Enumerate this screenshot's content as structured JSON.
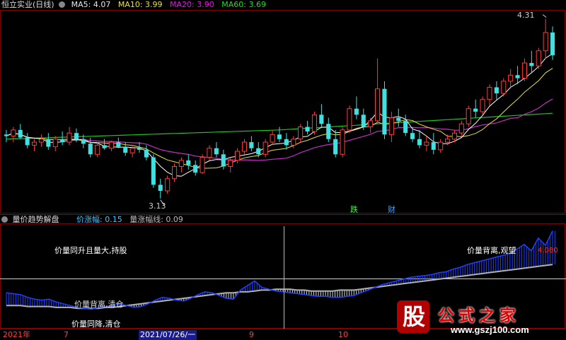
{
  "header": {
    "title": "恒立实业(日线)",
    "ma5_label": "MA5:",
    "ma5_value": "4.07",
    "ma10_label": "MA10:",
    "ma10_value": "3.99",
    "ma20_label": "MA20:",
    "ma20_value": "3.90",
    "ma60_label": "MA60:",
    "ma60_value": "3.69"
  },
  "sub_header": {
    "title": "量价趋势解盘",
    "line1_label": "价涨幅:",
    "line1_value": "0.15",
    "line2_label": "量涨幅线:",
    "line2_value": "0.09"
  },
  "annotations": {
    "high": "4.31",
    "low": "3.13",
    "event1": "跌",
    "event2": "财",
    "sub_value": "4.080",
    "text_hold": "价量同升且量大,持股",
    "text_watch": "价量背离,观望",
    "text_reduce": "价量背离,清仓",
    "text_clear": "价量同降,清仓"
  },
  "x_axis": {
    "labels": [
      "2021年",
      "7",
      "2021/07/26/一",
      "9",
      "10"
    ]
  },
  "watermark": {
    "char": "股",
    "text": "公式之家",
    "url": "www.gszj100.com"
  },
  "colors": {
    "up": "#ff3a3a",
    "down": "#40e0e0",
    "ma5": "#ffffff",
    "ma10": "#e8e040",
    "ma20": "#c030c0",
    "ma60": "#22c022",
    "sub_blue": "#2040ff",
    "sub_gray": "#b0b0b0",
    "grid_red": "#7a0000"
  },
  "chart_data": [
    {
      "type": "candlestick",
      "title": "恒立实业(日线)",
      "price_range": [
        3.05,
        4.35
      ],
      "candles": [
        [
          3.55,
          3.58,
          3.5,
          3.54
        ],
        [
          3.54,
          3.6,
          3.5,
          3.58
        ],
        [
          3.58,
          3.62,
          3.52,
          3.53
        ],
        [
          3.53,
          3.56,
          3.46,
          3.48
        ],
        [
          3.48,
          3.52,
          3.44,
          3.5
        ],
        [
          3.5,
          3.55,
          3.47,
          3.52
        ],
        [
          3.52,
          3.56,
          3.45,
          3.47
        ],
        [
          3.47,
          3.54,
          3.44,
          3.52
        ],
        [
          3.52,
          3.57,
          3.48,
          3.5
        ],
        [
          3.5,
          3.6,
          3.48,
          3.56
        ],
        [
          3.56,
          3.59,
          3.5,
          3.52
        ],
        [
          3.52,
          3.55,
          3.46,
          3.49
        ],
        [
          3.49,
          3.53,
          3.4,
          3.42
        ],
        [
          3.42,
          3.5,
          3.4,
          3.48
        ],
        [
          3.48,
          3.52,
          3.45,
          3.46
        ],
        [
          3.46,
          3.51,
          3.44,
          3.5
        ],
        [
          3.5,
          3.53,
          3.46,
          3.47
        ],
        [
          3.47,
          3.5,
          3.41,
          3.43
        ],
        [
          3.43,
          3.48,
          3.4,
          3.46
        ],
        [
          3.46,
          3.5,
          3.43,
          3.45
        ],
        [
          3.45,
          3.48,
          3.38,
          3.4
        ],
        [
          3.4,
          3.42,
          3.2,
          3.22
        ],
        [
          3.22,
          3.26,
          3.13,
          3.18
        ],
        [
          3.18,
          3.28,
          3.16,
          3.26
        ],
        [
          3.26,
          3.36,
          3.24,
          3.34
        ],
        [
          3.34,
          3.4,
          3.3,
          3.38
        ],
        [
          3.38,
          3.42,
          3.32,
          3.35
        ],
        [
          3.35,
          3.38,
          3.28,
          3.3
        ],
        [
          3.3,
          3.42,
          3.29,
          3.4
        ],
        [
          3.4,
          3.48,
          3.38,
          3.46
        ],
        [
          3.46,
          3.5,
          3.4,
          3.42
        ],
        [
          3.42,
          3.45,
          3.32,
          3.34
        ],
        [
          3.34,
          3.4,
          3.3,
          3.38
        ],
        [
          3.38,
          3.46,
          3.36,
          3.44
        ],
        [
          3.44,
          3.52,
          3.42,
          3.5
        ],
        [
          3.5,
          3.54,
          3.44,
          3.46
        ],
        [
          3.46,
          3.5,
          3.4,
          3.42
        ],
        [
          3.42,
          3.52,
          3.4,
          3.5
        ],
        [
          3.5,
          3.58,
          3.48,
          3.55
        ],
        [
          3.55,
          3.6,
          3.5,
          3.52
        ],
        [
          3.52,
          3.56,
          3.45,
          3.48
        ],
        [
          3.48,
          3.54,
          3.46,
          3.52
        ],
        [
          3.52,
          3.62,
          3.5,
          3.6
        ],
        [
          3.6,
          3.64,
          3.55,
          3.57
        ],
        [
          3.57,
          3.7,
          3.55,
          3.68
        ],
        [
          3.68,
          3.75,
          3.6,
          3.62
        ],
        [
          3.62,
          3.66,
          3.5,
          3.52
        ],
        [
          3.52,
          3.58,
          3.4,
          3.42
        ],
        [
          3.42,
          3.6,
          3.4,
          3.58
        ],
        [
          3.58,
          3.74,
          3.56,
          3.72
        ],
        [
          3.72,
          3.8,
          3.65,
          3.68
        ],
        [
          3.68,
          3.72,
          3.58,
          3.6
        ],
        [
          3.6,
          3.66,
          3.56,
          3.64
        ],
        [
          3.64,
          4.05,
          3.62,
          3.85
        ],
        [
          3.85,
          3.9,
          3.52,
          3.55
        ],
        [
          3.55,
          3.7,
          3.5,
          3.66
        ],
        [
          3.66,
          3.72,
          3.6,
          3.64
        ],
        [
          3.64,
          3.68,
          3.54,
          3.56
        ],
        [
          3.56,
          3.6,
          3.5,
          3.52
        ],
        [
          3.52,
          3.58,
          3.46,
          3.48
        ],
        [
          3.48,
          3.54,
          3.44,
          3.5
        ],
        [
          3.5,
          3.56,
          3.42,
          3.45
        ],
        [
          3.45,
          3.52,
          3.43,
          3.5
        ],
        [
          3.5,
          3.55,
          3.48,
          3.52
        ],
        [
          3.52,
          3.58,
          3.5,
          3.56
        ],
        [
          3.56,
          3.64,
          3.54,
          3.62
        ],
        [
          3.62,
          3.74,
          3.6,
          3.72
        ],
        [
          3.72,
          3.78,
          3.66,
          3.7
        ],
        [
          3.7,
          3.8,
          3.68,
          3.78
        ],
        [
          3.78,
          3.88,
          3.74,
          3.86
        ],
        [
          3.86,
          3.9,
          3.78,
          3.82
        ],
        [
          3.82,
          3.92,
          3.8,
          3.9
        ],
        [
          3.9,
          3.98,
          3.86,
          3.94
        ],
        [
          3.94,
          4.0,
          3.88,
          3.92
        ],
        [
          3.92,
          4.05,
          3.9,
          4.02
        ],
        [
          4.02,
          4.1,
          3.96,
          4.0
        ],
        [
          4.0,
          4.12,
          3.98,
          4.1
        ],
        [
          4.1,
          4.31,
          4.05,
          4.22
        ],
        [
          4.22,
          4.26,
          4.04,
          4.07
        ]
      ],
      "ma60": [
        3.52,
        3.58,
        3.69
      ],
      "high_label": 4.31,
      "low_label": 3.13
    },
    {
      "type": "line",
      "title": "量价趋势解盘",
      "series": [
        {
          "name": "价涨幅",
          "values": [
            0.02,
            0.01,
            0.0,
            -0.03,
            -0.05,
            -0.06,
            -0.05,
            -0.08,
            -0.1,
            -0.12,
            -0.14,
            -0.15,
            -0.16,
            -0.14,
            -0.13,
            -0.12,
            -0.1,
            -0.12,
            -0.14,
            -0.13,
            -0.1,
            -0.06,
            -0.03,
            -0.04,
            -0.06,
            -0.07,
            -0.04,
            0.0,
            0.03,
            0.02,
            -0.01,
            -0.04,
            -0.05,
            0.05,
            0.1,
            0.15,
            0.08,
            0.06,
            0.04,
            0.03,
            0.02,
            0.01,
            0.0,
            -0.01,
            -0.02,
            -0.02,
            -0.03,
            -0.03,
            -0.02,
            -0.01,
            0.02,
            0.05,
            0.08,
            0.11,
            0.13,
            0.15,
            0.17,
            0.19,
            0.2,
            0.21,
            0.22,
            0.24,
            0.25,
            0.28,
            0.3,
            0.33,
            0.35,
            0.37,
            0.39,
            0.41,
            0.43,
            0.45,
            0.5,
            0.55,
            0.48,
            0.62,
            0.54,
            0.7
          ]
        },
        {
          "name": "量涨幅线",
          "values": [
            -0.12,
            -0.12,
            -0.12,
            -0.13,
            -0.13,
            -0.13,
            -0.13,
            -0.14,
            -0.14,
            -0.14,
            -0.15,
            -0.15,
            -0.15,
            -0.15,
            -0.14,
            -0.14,
            -0.13,
            -0.12,
            -0.11,
            -0.1,
            -0.09,
            -0.08,
            -0.07,
            -0.06,
            -0.05,
            -0.04,
            -0.03,
            -0.02,
            -0.01,
            0.0,
            0.01,
            0.02,
            0.02,
            0.03,
            0.03,
            0.04,
            0.05,
            0.05,
            0.06,
            0.06,
            0.06,
            0.05,
            0.05,
            0.04,
            0.04,
            0.04,
            0.04,
            0.05,
            0.05,
            0.05,
            0.06,
            0.07,
            0.08,
            0.09,
            0.1,
            0.11,
            0.12,
            0.13,
            0.14,
            0.15,
            0.16,
            0.17,
            0.18,
            0.19,
            0.2,
            0.21,
            0.22,
            0.23,
            0.24,
            0.25,
            0.26,
            0.27,
            0.28,
            0.29,
            0.3,
            0.31,
            0.32,
            0.33
          ]
        }
      ],
      "ylim": [
        -0.35,
        0.75
      ]
    }
  ]
}
